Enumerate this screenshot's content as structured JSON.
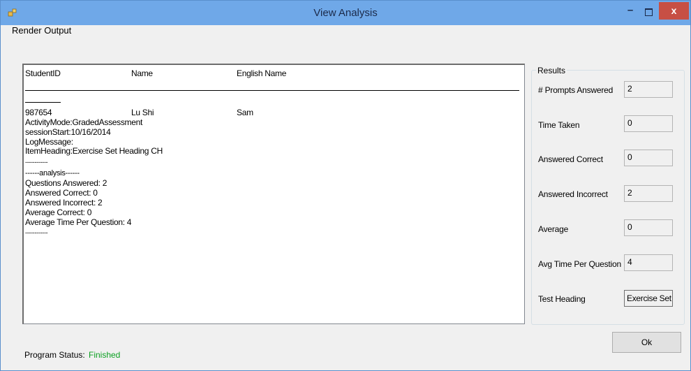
{
  "window": {
    "title": "View Analysis"
  },
  "menu": {
    "items": [
      "Render Output"
    ]
  },
  "output": {
    "headers": [
      "StudentID",
      "Name",
      "English Name"
    ],
    "record": {
      "student_id": "987654",
      "name": "Lu Shi",
      "english_name": "Sam"
    },
    "lines": [
      "ActivityMode:GradedAssessment",
      "sessionStart:10/16/2014",
      "LogMessage:",
      "ItemHeading:Exercise Set Heading CH",
      "------------",
      "------analysis------",
      "Questions Answered: 2",
      "Answered Correct: 0",
      "Answered Incorrect: 2",
      "Average Correct: 0",
      "Average Time Per Question: 4",
      "------------"
    ]
  },
  "results": {
    "legend": "Results",
    "fields": [
      {
        "label": "# Prompts Answered",
        "value": "2"
      },
      {
        "label": "Time Taken",
        "value": "0"
      },
      {
        "label": "Answered Correct",
        "value": "0"
      },
      {
        "label": "Answered Incorrect",
        "value": "2"
      },
      {
        "label": "Average",
        "value": "0"
      },
      {
        "label": "Avg Time Per Question",
        "value": "4"
      }
    ],
    "test_heading": {
      "label": "Test Heading",
      "value": "Exercise Set"
    }
  },
  "buttons": {
    "ok": "Ok",
    "minimize": "–",
    "close": "x"
  },
  "status": {
    "label": "Program Status:",
    "value": "Finished",
    "value_color": "#0a9f20"
  },
  "colors": {
    "titlebar": "#6fa8e8",
    "close_button": "#c74f44"
  }
}
